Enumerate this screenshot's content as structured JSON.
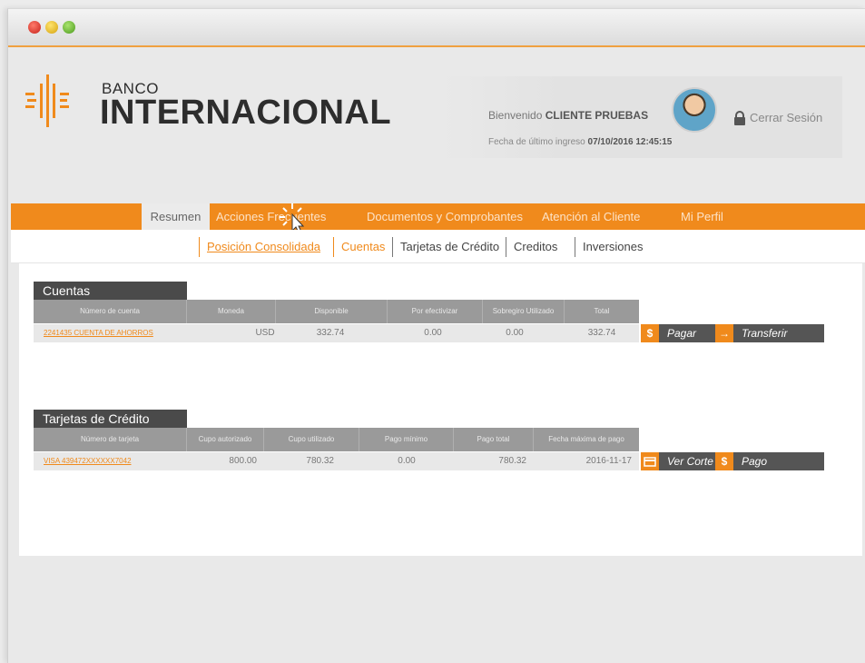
{
  "window": {
    "controls": [
      "close",
      "minimize",
      "maximize"
    ]
  },
  "brand": {
    "small": "BANCO",
    "name": "INTERNACIONAL"
  },
  "user": {
    "welcome_prefix": "Bienvenido",
    "name": "CLIENTE PRUEBAS",
    "last_login_label": "Fecha de último ingreso",
    "last_login_value": "07/10/2016 12:45:15",
    "logout": "Cerrar Sesión"
  },
  "nav": {
    "items": [
      "Resumen",
      "Acciones Frecuentes",
      "Documentos y Comprobantes",
      "Atención al Cliente",
      "Mi Perfil"
    ],
    "active": "Resumen"
  },
  "subnav": {
    "items": [
      "Posición Consolidada",
      "Cuentas",
      "Tarjetas de Crédito",
      "Creditos",
      "Inversiones"
    ],
    "active": "Posición Consolidada"
  },
  "cuentas": {
    "title": "Cuentas",
    "headers": [
      "Número de cuenta",
      "Moneda",
      "Disponible",
      "Por efectivizar",
      "Sobregiro Utilizado",
      "Total"
    ],
    "rows": [
      {
        "account": "2241435 CUENTA DE AHORROS",
        "currency": "USD",
        "available": "332.74",
        "pending": "0.00",
        "overdraft": "0.00",
        "total": "332.74"
      }
    ],
    "actions": {
      "pay_icon": "$",
      "pay": "Pagar",
      "transfer_icon": "→",
      "transfer": "Transferir"
    }
  },
  "tarjetas": {
    "title": "Tarjetas de Crédito",
    "headers": [
      "Número de tarjeta",
      "Cupo autorizado",
      "Cupo utilizado",
      "Pago mínimo",
      "Pago total",
      "Fecha máxima de pago"
    ],
    "rows": [
      {
        "card": "VISA 439472XXXXXX7042",
        "authorized": "800.00",
        "used": "780.32",
        "min_payment": "0.00",
        "total_payment": "780.32",
        "due_date": "2016-11-17"
      }
    ],
    "actions": {
      "statement_icon": "card-icon",
      "statement": "Ver Corte",
      "pay_icon": "$",
      "pay": "Pago"
    }
  },
  "colors": {
    "accent": "#f08a1c",
    "dark": "#4a4a4a",
    "header_gray": "#9a9a9a"
  }
}
